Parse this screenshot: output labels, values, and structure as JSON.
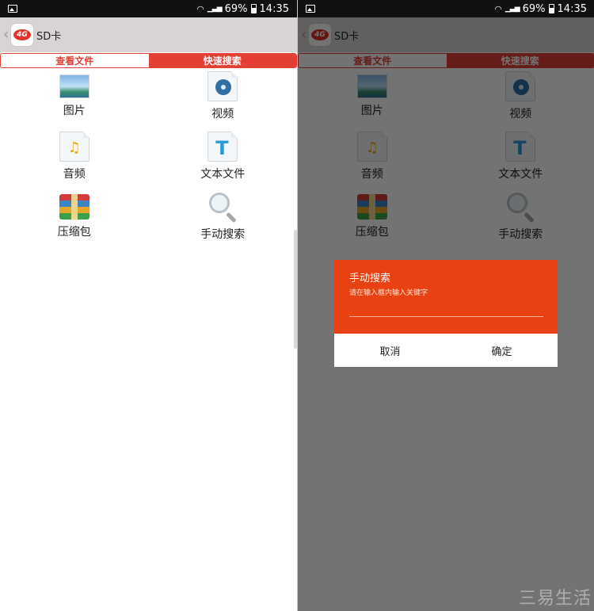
{
  "status": {
    "battery": "69%",
    "time": "14:35"
  },
  "app": {
    "title": "SD卡"
  },
  "tabs": [
    {
      "label": "查看文件",
      "active": true
    },
    {
      "label": "快速搜索",
      "active": false
    }
  ],
  "categories": [
    {
      "label": "图片",
      "icon": "picture-icon"
    },
    {
      "label": "视频",
      "icon": "video-icon"
    },
    {
      "label": "音频",
      "icon": "audio-icon"
    },
    {
      "label": "文本文件",
      "icon": "text-file-icon"
    },
    {
      "label": "压缩包",
      "icon": "archive-icon"
    },
    {
      "label": "手动搜索",
      "icon": "magnifier-icon"
    }
  ],
  "dialog": {
    "title": "手动搜索",
    "hint": "请在输入框内输入关键字",
    "cancel_label": "取消",
    "confirm_label": "确定"
  },
  "watermark": "三易生活",
  "colors": {
    "accent": "#e33f35",
    "dialog_header": "#e84112",
    "statusbar": "#111111",
    "appbar": "#d9d3d3"
  }
}
